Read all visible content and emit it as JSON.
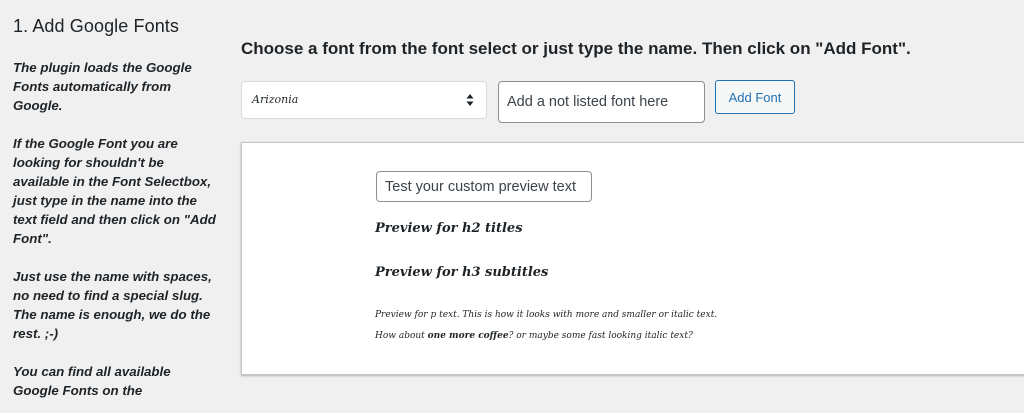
{
  "sidebar": {
    "title": "1. Add Google Fonts",
    "paragraphs": [
      "The plugin loads the Google Fonts automatically from Google.",
      "If the Google Font you are looking for shouldn't be available in the Font Selectbox, just type in the name into the text field and then click on \"Add Font\".",
      "Just use the name with spaces, no need to find a special slug. The name is enough, we do the rest. ;-)",
      "You can find all available Google Fonts on the"
    ]
  },
  "main": {
    "heading": "Choose a font from the font select or just type the name. Then click on \"Add Font\".",
    "font_select": {
      "selected": "Arizonia"
    },
    "font_input": {
      "placeholder": "Add a not listed font here",
      "value": ""
    },
    "add_button": "Add Font",
    "preview": {
      "input_placeholder": "Test your custom preview text",
      "h2": "Preview for h2 titles",
      "h3": "Preview for h3 subtitles",
      "p_line1": "Preview for p text. This is how it looks with more and smaller or italic text.",
      "p_line2_before": "How about ",
      "p_line2_bold": "one more coffee",
      "p_line2_after": "? or maybe some fast looking italic text?"
    }
  }
}
